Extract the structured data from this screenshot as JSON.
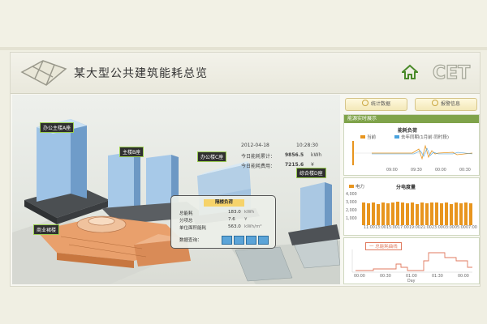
{
  "app": {
    "title": "某大型公共建筑能耗总览",
    "logo_text": "CET"
  },
  "info": {
    "date": "2012-04-18",
    "time": "10:28:30",
    "today_energy_label": "今日能耗累计：",
    "today_energy_value": "9856.5",
    "today_energy_unit": "kWh",
    "today_cost_label": "今日能耗费用：",
    "today_cost_value": "7215.6",
    "today_cost_unit": "¥"
  },
  "buildings": [
    {
      "label": "办公主楼A座"
    },
    {
      "label": "主楼B座"
    },
    {
      "label": "办公楼C座"
    },
    {
      "label": "综合楼D座"
    },
    {
      "label": "商业裙楼"
    }
  ],
  "popup": {
    "title": "隔楼负荷",
    "rows": [
      {
        "label": "总能耗",
        "value": "183.0",
        "unit": "kWh"
      },
      {
        "label": "分项总",
        "value": "7.6",
        "unit": "¥"
      },
      {
        "label": "单位面积能耗",
        "value": "563.0",
        "unit": "kWh/m²"
      }
    ],
    "actions_label": "数据查询："
  },
  "toolbar": {
    "stats_label": "统计数据",
    "alarm_label": "报警信息"
  },
  "panels": {
    "realtime_title": "能源实时展示",
    "c1_title": "能耗负荷",
    "c1_series": [
      "当前",
      "去年同期(1月前·同时段)"
    ],
    "c1_x": [
      "09:00",
      "09:30",
      "00:00",
      "00:30"
    ],
    "c2_title": "分电度量",
    "c2_legend": "电力",
    "c2_y": [
      "4,000",
      "3,000",
      "2,000",
      "1,000"
    ],
    "c2_x": [
      "11:00",
      "13:00",
      "15:00",
      "17:00",
      "19:00",
      "21:00",
      "23:00",
      "03:00",
      "05:00",
      "07:00"
    ],
    "c3_legend": "一 总能耗曲线",
    "c3_x": [
      "00:00",
      "00:30",
      "01:00",
      "01:30",
      "00:00"
    ],
    "c3_xlabel": "Day"
  },
  "colors": {
    "accent_green": "#7fa34a",
    "orange": "#e8951e",
    "red_line": "#e07a5f"
  }
}
